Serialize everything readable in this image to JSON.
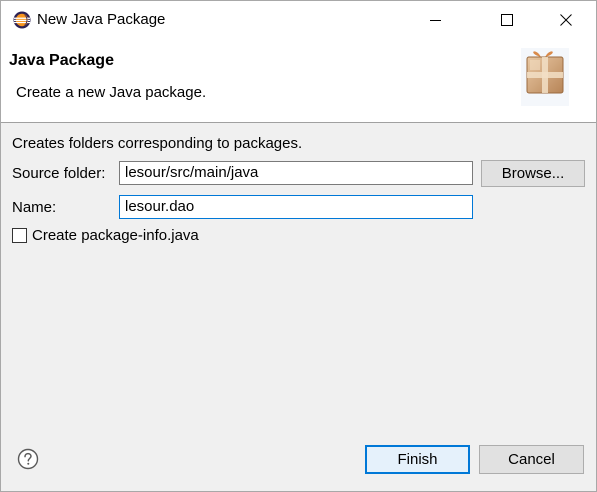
{
  "window": {
    "title": "New Java Package",
    "controls": {
      "minimize": "—",
      "maximize": "☐",
      "close": "✕"
    }
  },
  "banner": {
    "title": "Java Package",
    "description": "Create a new Java package."
  },
  "form": {
    "subtitle": "Creates folders corresponding to packages.",
    "source_folder_label": "Source folder:",
    "source_folder_value": "lesour/src/main/java",
    "browse_label": "Browse...",
    "name_label": "Name:",
    "name_value": "lesour.dao",
    "package_info_label": "Create package-info.java",
    "package_info_checked": false
  },
  "footer": {
    "help_icon": "question-mark-icon",
    "finish_label": "Finish",
    "cancel_label": "Cancel"
  },
  "colors": {
    "focus_accent": "#0078d7",
    "dialog_bg": "#f0f0f0",
    "button_bg": "#e1e1e1"
  }
}
